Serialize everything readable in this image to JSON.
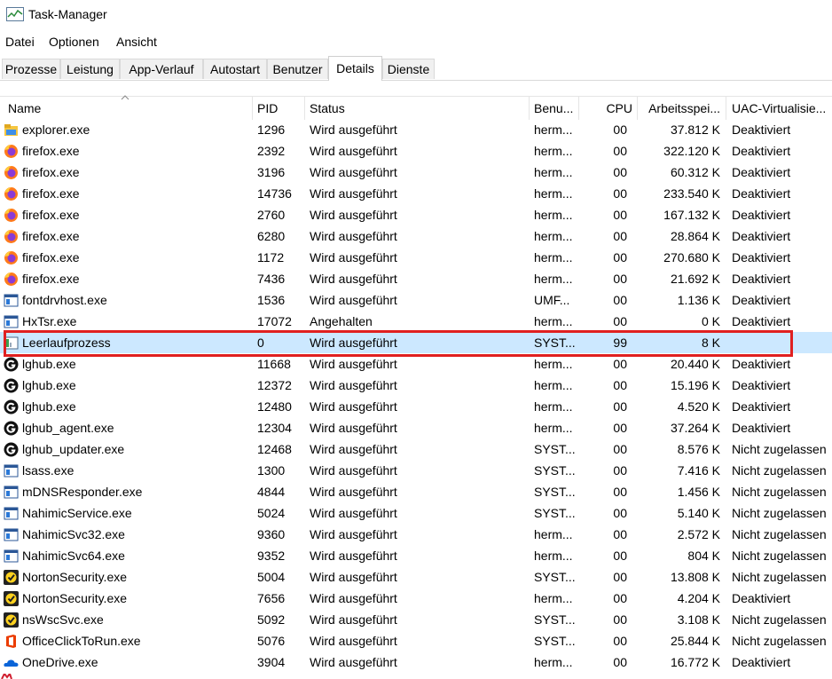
{
  "window": {
    "title": "Task-Manager"
  },
  "menu": [
    "Datei",
    "Optionen",
    "Ansicht"
  ],
  "tabs": [
    {
      "label": "Prozesse",
      "active": false
    },
    {
      "label": "Leistung",
      "active": false
    },
    {
      "label": "App-Verlauf",
      "active": false
    },
    {
      "label": "Autostart",
      "active": false
    },
    {
      "label": "Benutzer",
      "active": false
    },
    {
      "label": "Details",
      "active": true
    },
    {
      "label": "Dienste",
      "active": false
    }
  ],
  "columns": [
    "Name",
    "PID",
    "Status",
    "Benu...",
    "CPU",
    "Arbeitsspei...",
    "UAC-Virtualisie..."
  ],
  "selected_row": 10,
  "highlight_color": "#e02020",
  "rows": [
    {
      "icon": "explorer-icon",
      "name": "explorer.exe",
      "pid": "1296",
      "status": "Wird ausgeführt",
      "user": "herm...",
      "cpu": "00",
      "mem": "37.812 K",
      "uac": "Deaktiviert"
    },
    {
      "icon": "firefox-icon",
      "name": "firefox.exe",
      "pid": "2392",
      "status": "Wird ausgeführt",
      "user": "herm...",
      "cpu": "00",
      "mem": "322.120 K",
      "uac": "Deaktiviert"
    },
    {
      "icon": "firefox-icon",
      "name": "firefox.exe",
      "pid": "3196",
      "status": "Wird ausgeführt",
      "user": "herm...",
      "cpu": "00",
      "mem": "60.312 K",
      "uac": "Deaktiviert"
    },
    {
      "icon": "firefox-icon",
      "name": "firefox.exe",
      "pid": "14736",
      "status": "Wird ausgeführt",
      "user": "herm...",
      "cpu": "00",
      "mem": "233.540 K",
      "uac": "Deaktiviert"
    },
    {
      "icon": "firefox-icon",
      "name": "firefox.exe",
      "pid": "2760",
      "status": "Wird ausgeführt",
      "user": "herm...",
      "cpu": "00",
      "mem": "167.132 K",
      "uac": "Deaktiviert"
    },
    {
      "icon": "firefox-icon",
      "name": "firefox.exe",
      "pid": "6280",
      "status": "Wird ausgeführt",
      "user": "herm...",
      "cpu": "00",
      "mem": "28.864 K",
      "uac": "Deaktiviert"
    },
    {
      "icon": "firefox-icon",
      "name": "firefox.exe",
      "pid": "1172",
      "status": "Wird ausgeführt",
      "user": "herm...",
      "cpu": "00",
      "mem": "270.680 K",
      "uac": "Deaktiviert"
    },
    {
      "icon": "firefox-icon",
      "name": "firefox.exe",
      "pid": "7436",
      "status": "Wird ausgeführt",
      "user": "herm...",
      "cpu": "00",
      "mem": "21.692 K",
      "uac": "Deaktiviert"
    },
    {
      "icon": "window-app-icon",
      "name": "fontdrvhost.exe",
      "pid": "1536",
      "status": "Wird ausgeführt",
      "user": "UMF...",
      "cpu": "00",
      "mem": "1.136 K",
      "uac": "Deaktiviert"
    },
    {
      "icon": "window-app-icon",
      "name": "HxTsr.exe",
      "pid": "17072",
      "status": "Angehalten",
      "user": "herm...",
      "cpu": "00",
      "mem": "0 K",
      "uac": "Deaktiviert"
    },
    {
      "icon": "idle-process-icon",
      "name": "Leerlaufprozess",
      "pid": "0",
      "status": "Wird ausgeführt",
      "user": "SYST...",
      "cpu": "99",
      "mem": "8 K",
      "uac": ""
    },
    {
      "icon": "logitech-icon",
      "name": "lghub.exe",
      "pid": "11668",
      "status": "Wird ausgeführt",
      "user": "herm...",
      "cpu": "00",
      "mem": "20.440 K",
      "uac": "Deaktiviert"
    },
    {
      "icon": "logitech-icon",
      "name": "lghub.exe",
      "pid": "12372",
      "status": "Wird ausgeführt",
      "user": "herm...",
      "cpu": "00",
      "mem": "15.196 K",
      "uac": "Deaktiviert"
    },
    {
      "icon": "logitech-icon",
      "name": "lghub.exe",
      "pid": "12480",
      "status": "Wird ausgeführt",
      "user": "herm...",
      "cpu": "00",
      "mem": "4.520 K",
      "uac": "Deaktiviert"
    },
    {
      "icon": "logitech-icon",
      "name": "lghub_agent.exe",
      "pid": "12304",
      "status": "Wird ausgeführt",
      "user": "herm...",
      "cpu": "00",
      "mem": "37.264 K",
      "uac": "Deaktiviert"
    },
    {
      "icon": "logitech-icon",
      "name": "lghub_updater.exe",
      "pid": "12468",
      "status": "Wird ausgeführt",
      "user": "SYST...",
      "cpu": "00",
      "mem": "8.576 K",
      "uac": "Nicht zugelassen"
    },
    {
      "icon": "window-app-icon",
      "name": "lsass.exe",
      "pid": "1300",
      "status": "Wird ausgeführt",
      "user": "SYST...",
      "cpu": "00",
      "mem": "7.416 K",
      "uac": "Nicht zugelassen"
    },
    {
      "icon": "window-app-icon",
      "name": "mDNSResponder.exe",
      "pid": "4844",
      "status": "Wird ausgeführt",
      "user": "SYST...",
      "cpu": "00",
      "mem": "1.456 K",
      "uac": "Nicht zugelassen"
    },
    {
      "icon": "window-app-icon",
      "name": "NahimicService.exe",
      "pid": "5024",
      "status": "Wird ausgeführt",
      "user": "SYST...",
      "cpu": "00",
      "mem": "5.140 K",
      "uac": "Nicht zugelassen"
    },
    {
      "icon": "window-app-icon",
      "name": "NahimicSvc32.exe",
      "pid": "9360",
      "status": "Wird ausgeführt",
      "user": "herm...",
      "cpu": "00",
      "mem": "2.572 K",
      "uac": "Nicht zugelassen"
    },
    {
      "icon": "window-app-icon",
      "name": "NahimicSvc64.exe",
      "pid": "9352",
      "status": "Wird ausgeführt",
      "user": "herm...",
      "cpu": "00",
      "mem": "804 K",
      "uac": "Nicht zugelassen"
    },
    {
      "icon": "norton-icon",
      "name": "NortonSecurity.exe",
      "pid": "5004",
      "status": "Wird ausgeführt",
      "user": "SYST...",
      "cpu": "00",
      "mem": "13.808 K",
      "uac": "Nicht zugelassen"
    },
    {
      "icon": "norton-icon",
      "name": "NortonSecurity.exe",
      "pid": "7656",
      "status": "Wird ausgeführt",
      "user": "herm...",
      "cpu": "00",
      "mem": "4.204 K",
      "uac": "Deaktiviert"
    },
    {
      "icon": "norton-icon",
      "name": "nsWscSvc.exe",
      "pid": "5092",
      "status": "Wird ausgeführt",
      "user": "SYST...",
      "cpu": "00",
      "mem": "3.108 K",
      "uac": "Nicht zugelassen"
    },
    {
      "icon": "office-icon",
      "name": "OfficeClickToRun.exe",
      "pid": "5076",
      "status": "Wird ausgeführt",
      "user": "SYST...",
      "cpu": "00",
      "mem": "25.844 K",
      "uac": "Nicht zugelassen"
    },
    {
      "icon": "onedrive-icon",
      "name": "OneDrive.exe",
      "pid": "3904",
      "status": "Wird ausgeführt",
      "user": "herm...",
      "cpu": "00",
      "mem": "16.772 K",
      "uac": "Deaktiviert"
    }
  ]
}
